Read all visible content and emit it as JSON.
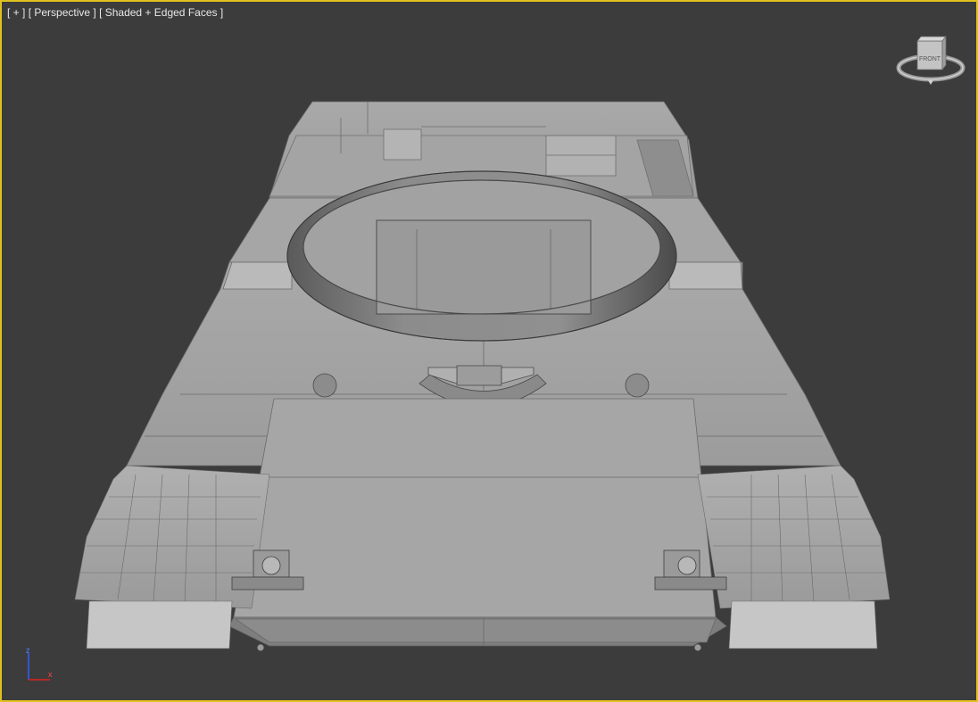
{
  "viewport": {
    "labels": {
      "menu": "[ + ]",
      "view": "[ Perspective ]",
      "shading": "[ Shaded + Edged Faces ]"
    },
    "active_border_color": "#e0c21e",
    "background_color": "#3c3c3c",
    "viewcube": {
      "face_label": "FRONT",
      "icon": "viewcube-icon"
    },
    "axis_tripod": {
      "z_label": "z",
      "x_label": "x",
      "colors": {
        "z": "#3060ff",
        "x": "#e02020"
      }
    }
  }
}
